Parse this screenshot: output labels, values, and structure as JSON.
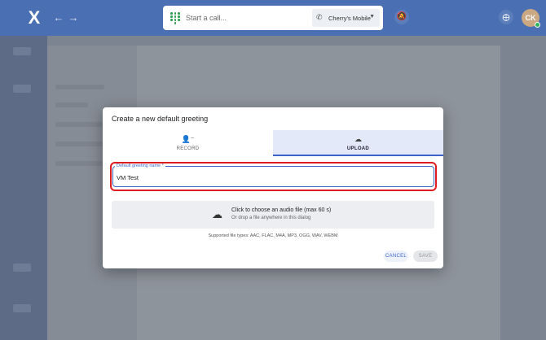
{
  "topbar": {
    "logo": "X",
    "call_placeholder": "Start a call...",
    "device": "Cherry's Mobile",
    "avatar_initials": "CK"
  },
  "dialog": {
    "title": "Create a new default greeting",
    "tabs": [
      {
        "label": "RECORD",
        "icon": "record-voice-icon",
        "selected": false
      },
      {
        "label": "UPLOAD",
        "icon": "cloud-upload-icon",
        "selected": true
      }
    ],
    "name_field": {
      "label": "Default greeting name *",
      "value": "VM Test"
    },
    "dropzone": {
      "main_text": "Click to choose an audio file (max 60 s)",
      "sub_text": "Or drop a file anywhere in this dialog"
    },
    "file_types": "Supported file types: AAC, FLAC, M4A, MP3, OGG, WAV, WEBM",
    "cancel_label": "CANCEL",
    "save_label": "SAVE"
  },
  "colors": {
    "topbar": "#4a6fb2",
    "accent": "#3c64c8",
    "highlight": "#e11b22",
    "status_online": "#2fb45a"
  }
}
